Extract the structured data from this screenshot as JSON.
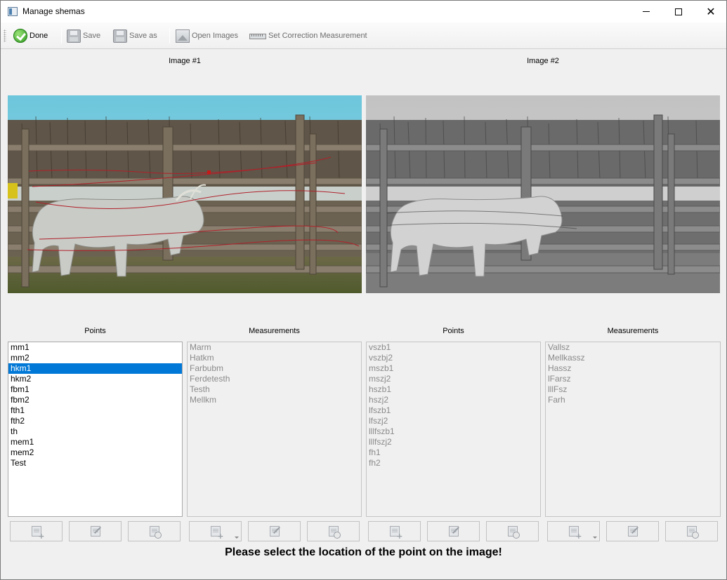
{
  "window": {
    "title": "Manage shemas"
  },
  "toolbar": {
    "done_label": "Done",
    "save_label": "Save",
    "save_as_label": "Save as",
    "open_images_label": "Open Images",
    "set_correction_label": "Set Correction Measurement"
  },
  "images": {
    "image1_title": "Image #1",
    "image2_title": "Image #2"
  },
  "left": {
    "points_header": "Points",
    "measurements_header": "Measurements",
    "points": [
      "mm1",
      "mm2",
      "hkm1",
      "hkm2",
      "fbm1",
      "fbm2",
      "fth1",
      "fth2",
      "th",
      "mem1",
      "mem2",
      "Test"
    ],
    "selected_point": "hkm1",
    "measurements": [
      "Marm",
      "Hatkm",
      "Farbubm",
      "Ferdetesth",
      "Testh",
      "Mellkm"
    ]
  },
  "right": {
    "points_header": "Points",
    "measurements_header": "Measurements",
    "points": [
      "vszb1",
      "vszbj2",
      "mszb1",
      "mszj2",
      "hszb1",
      "hszj2",
      "lfszb1",
      "lfszj2",
      "lllfszb1",
      "lllfszj2",
      "fh1",
      "fh2"
    ],
    "measurements": [
      "Vallsz",
      "Mellkassz",
      "Hassz",
      "lFarsz",
      "lllFsz",
      "Farh"
    ]
  },
  "status": {
    "message": "Please select the location of the point on the image!"
  },
  "colors": {
    "selection": "#0078d7",
    "annotation_line": "#b0202a"
  }
}
